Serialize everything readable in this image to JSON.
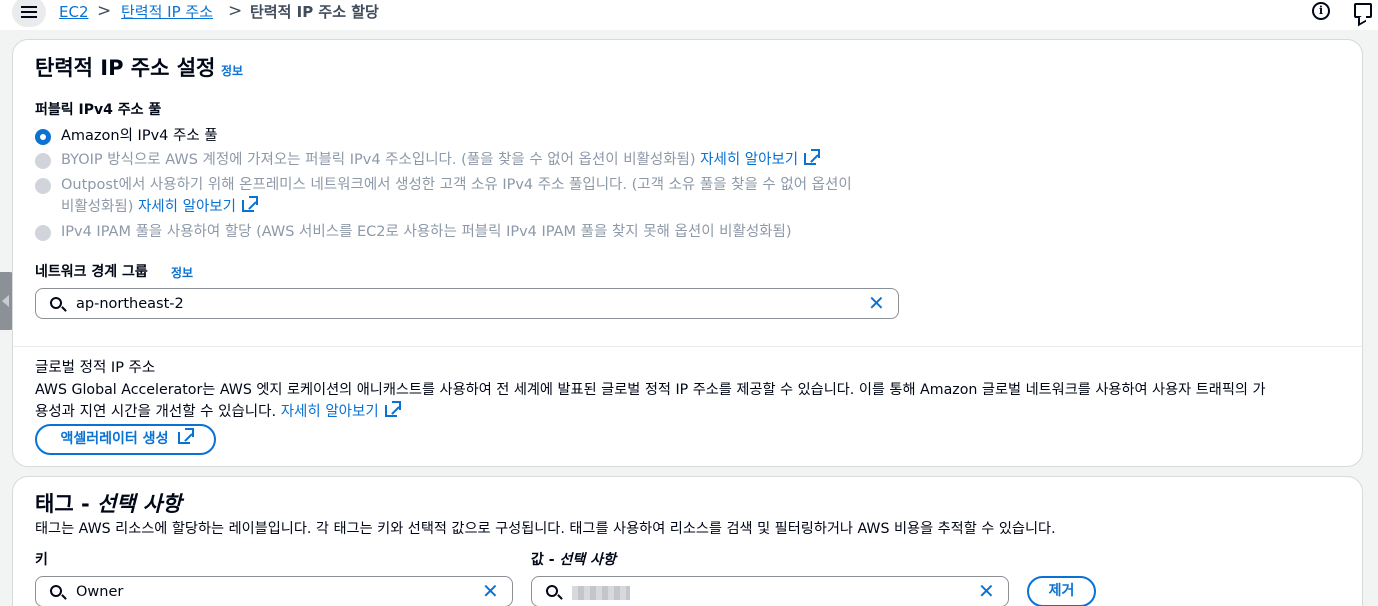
{
  "breadcrumb": {
    "items": [
      "EC2",
      "탄력적 IP 주소",
      "탄력적 IP 주소 할당"
    ],
    "separator": ">"
  },
  "settings": {
    "title": "탄력적 IP 주소 설정",
    "info": "정보",
    "pool_label": "퍼블릭 IPv4 주소 풀",
    "options": [
      {
        "label": "Amazon의 IPv4 주소 풀",
        "selected": true,
        "enabled": true
      },
      {
        "label": "BYOIP 방식으로 AWS 계정에 가져오는 퍼블릭 IPv4 주소입니다. (풀을 찾을 수 없어 옵션이 비활성화됨)",
        "link": "자세히 알아보기",
        "enabled": false
      },
      {
        "label_line1": "Outpost에서 사용하기 위해 온프레미스 네트워크에서 생성한 고객 소유 IPv4 주소 풀입니다. (고객 소유 풀을 찾을 수 없어 옵션이",
        "label_line2": "비활성화됨)",
        "link": "자세히 알아보기",
        "enabled": false
      },
      {
        "label": "IPv4 IPAM 풀을 사용하여 할당 (AWS 서비스를 EC2로 사용하는 퍼블릭 IPv4 IPAM 풀을 찾지 못해 옵션이 비활성화됨)",
        "enabled": false
      }
    ],
    "nbg_label": "네트워크 경계 그룹",
    "nbg_info": "정보",
    "nbg_value": "ap-northeast-2"
  },
  "global": {
    "title": "글로벌 정적 IP 주소",
    "desc_line1": "AWS Global Accelerator는 AWS 엣지 로케이션의 애니캐스트를 사용하여 전 세계에 발표된 글로벌 정적 IP 주소를 제공할 수 있습니다. 이를 통해 Amazon 글로벌 네트워크를 사용하여 사용자 트래픽의 가",
    "desc_line2": "용성과 지연 시간을 개선할 수 있습니다.",
    "link": "자세히 알아보기",
    "button": "액셀러레이터 생성"
  },
  "tags": {
    "title_main": "태그 - ",
    "title_italic": "선택 사항",
    "desc": "태그는 AWS 리소스에 할당하는 레이블입니다. 각 태그는 키와 선택적 값으로 구성됩니다. 태그를 사용하여 리소스를 검색 및 필터링하거나 AWS 비용을 추적할 수 있습니다.",
    "key_label": "키",
    "value_label_main": "값 - ",
    "value_label_italic": "선택 사항",
    "key_value": "Owner",
    "remove": "제거"
  },
  "icons": [
    "menu-icon",
    "info-circle-icon",
    "feedback-icon",
    "external-link-icon",
    "search-icon",
    "clear-icon"
  ],
  "colors": {
    "link": "#0972d3",
    "text": "#000716",
    "disabled": "#8d99a8"
  }
}
